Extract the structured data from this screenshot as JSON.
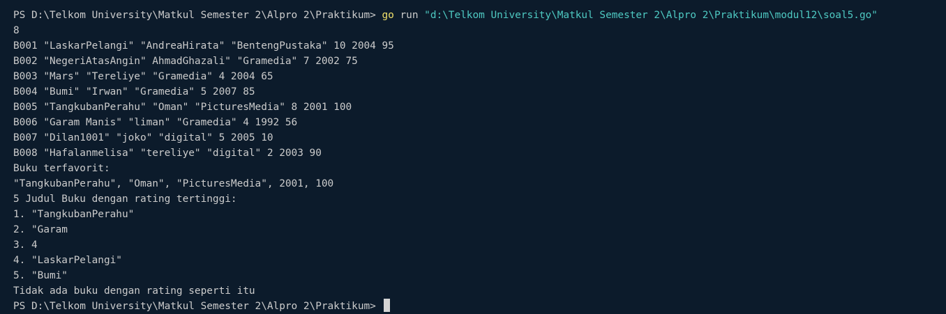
{
  "terminal": {
    "prompt1": "PS D:\\Telkom University\\Matkul Semester 2\\Alpro 2\\Praktikum> ",
    "command": "go",
    "command_arg": " run ",
    "command_path": "\"d:\\Telkom University\\Matkul Semester 2\\Alpro 2\\Praktikum\\modul12\\soal5.go\"",
    "output_lines": [
      "8",
      "B001 \"LaskarPelangi\" \"AndreaHirata\" \"BentengPustaka\" 10 2004 95",
      "B002 \"NegeriAtasAngin\" AhmadGhazali\" \"Gramedia\" 7 2002 75",
      "B003 \"Mars\" \"Tereliye\" \"Gramedia\" 4 2004 65",
      "B004 \"Bumi\" \"Irwan\" \"Gramedia\" 5 2007 85",
      "B005 \"TangkubanPerahu\" \"Oman\" \"PicturesMedia\" 8 2001 100",
      "B006 \"Garam Manis\" \"liman\" \"Gramedia\" 4 1992 56",
      "B007 \"Dilan1001\" \"joko\" \"digital\" 5 2005 10",
      "B008 \"Hafalanmelisa\" \"tereliye\" \"digital\" 2 2003 90",
      "Buku terfavorit:",
      "\"TangkubanPerahu\", \"Oman\", \"PicturesMedia\", 2001, 100",
      "5 Judul Buku dengan rating tertinggi:",
      "1. \"TangkubanPerahu\"",
      "2. \"Garam",
      "3. 4",
      "4. \"LaskarPelangi\"",
      "5. \"Bumi\"",
      "Tidak ada buku dengan rating seperti itu"
    ],
    "prompt2": "PS D:\\Telkom University\\Matkul Semester 2\\Alpro 2\\Praktikum> "
  },
  "colors": {
    "background": "#0c1b2b",
    "text": "#cccccc",
    "command": "#f0e06a",
    "string": "#4ec9c2",
    "cursor": "#d4d4d4"
  }
}
